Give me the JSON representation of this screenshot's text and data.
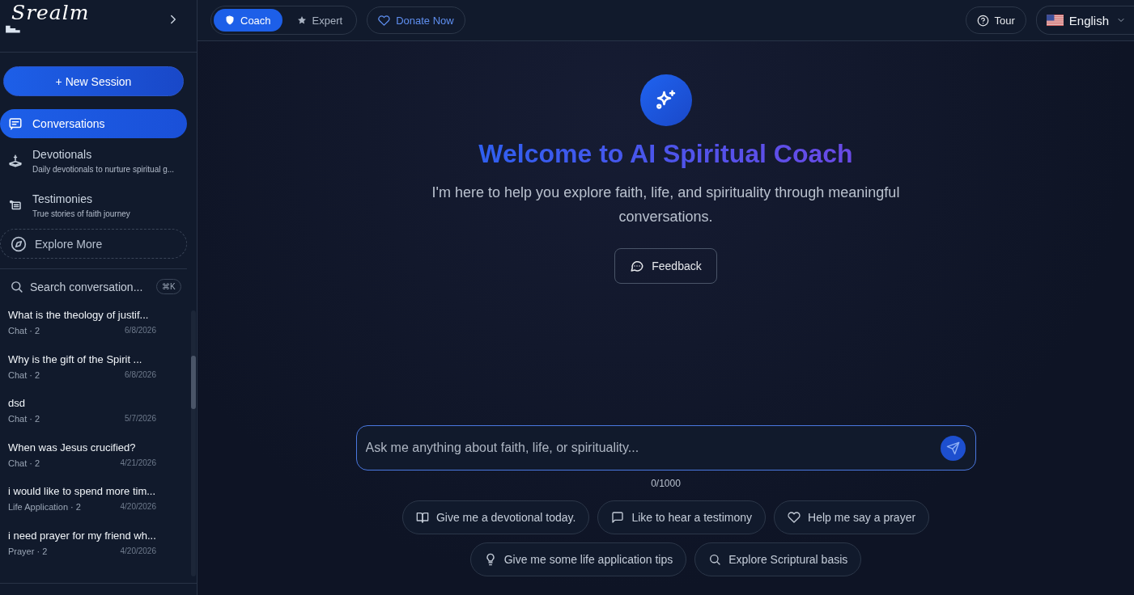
{
  "logo": "Srealm",
  "modes": [
    {
      "label": "Coach",
      "selected": true
    },
    {
      "label": "Expert",
      "selected": false
    }
  ],
  "donate": "Donate Now",
  "tour": "Tour",
  "language": "English",
  "new_session": "+ New Session",
  "nav": [
    {
      "title": "Conversations",
      "selected": true
    },
    {
      "title": "Devotionals",
      "subtitle": "Daily devotionals to nurture spiritual g...",
      "selected": false
    },
    {
      "title": "Testimonies",
      "subtitle": "True stories of faith journey",
      "selected": false
    }
  ],
  "explore": "Explore More",
  "search": {
    "placeholder": "Search conversation...",
    "shortcut": "⌘K"
  },
  "conversations": [
    {
      "title": "What is the theology of justif...",
      "meta": "Chat · 2",
      "date": "6/8/2026"
    },
    {
      "title": "Why is the gift of the Spirit ...",
      "meta": "Chat · 2",
      "date": "6/8/2026"
    },
    {
      "title": "dsd",
      "meta": "Chat · 2",
      "date": "5/7/2026"
    },
    {
      "title": "When was Jesus crucified?",
      "meta": "Chat · 2",
      "date": "4/21/2026"
    },
    {
      "title": "i would like to spend more tim...",
      "meta": "Life Application · 2",
      "date": "4/20/2026"
    },
    {
      "title": "i need prayer for my friend wh...",
      "meta": "Prayer · 2",
      "date": "4/20/2026"
    }
  ],
  "welcome": {
    "title": "Welcome to AI Spiritual Coach",
    "subtitle": "I'm here to help you explore faith, life, and spirituality through meaningful conversations.",
    "feedback": "Feedback"
  },
  "composer": {
    "placeholder": "Ask me anything about faith, life, or spirituality...",
    "counter": "0/1000"
  },
  "suggestions": [
    [
      "Give me a devotional today.",
      "Like to hear a testimony",
      "Help me say a prayer"
    ],
    [
      "Give me some life application tips",
      "Explore Scriptural basis"
    ]
  ]
}
